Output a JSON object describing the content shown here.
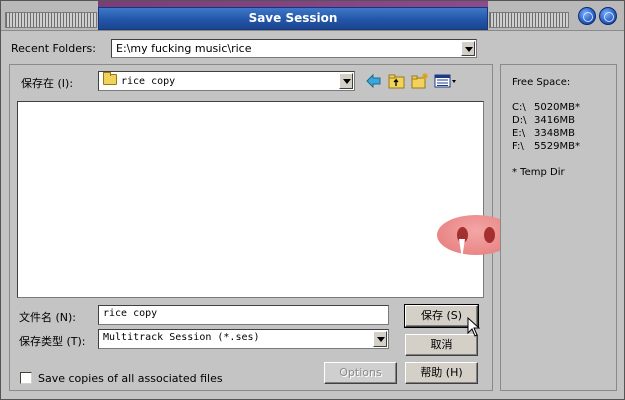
{
  "window": {
    "title": "Save Session"
  },
  "recent": {
    "label": "Recent Folders:",
    "value": "E:\\my fucking music\\rice"
  },
  "save_in": {
    "label": "保存在 (I):",
    "value": "rice copy"
  },
  "toolbar": {
    "icons": [
      "back-arrow-icon",
      "up-folder-icon",
      "new-folder-icon",
      "view-menu-icon"
    ]
  },
  "filename": {
    "label": "文件名 (N):",
    "value": "rice copy"
  },
  "filetype": {
    "label": "保存类型 (T):",
    "value": "Multitrack Session (*.ses)"
  },
  "buttons": {
    "save": "保存 (S)",
    "cancel": "取消",
    "help": "帮助 (H)",
    "options": "Options"
  },
  "checkbox": {
    "label": "Save copies of all associated files",
    "checked": false
  },
  "sidebar": {
    "title": "Free Space:",
    "drives": [
      {
        "drive": "C:\\",
        "space": "5020MB*"
      },
      {
        "drive": "D:\\",
        "space": "3416MB"
      },
      {
        "drive": "E:\\",
        "space": "3348MB"
      },
      {
        "drive": "F:\\",
        "space": "5529MB*"
      }
    ],
    "note": "* Temp Dir"
  },
  "colors": {
    "title_bar": "#2456a8",
    "window_bg": "#c4c4c4",
    "pig_nose": "#e98686"
  }
}
